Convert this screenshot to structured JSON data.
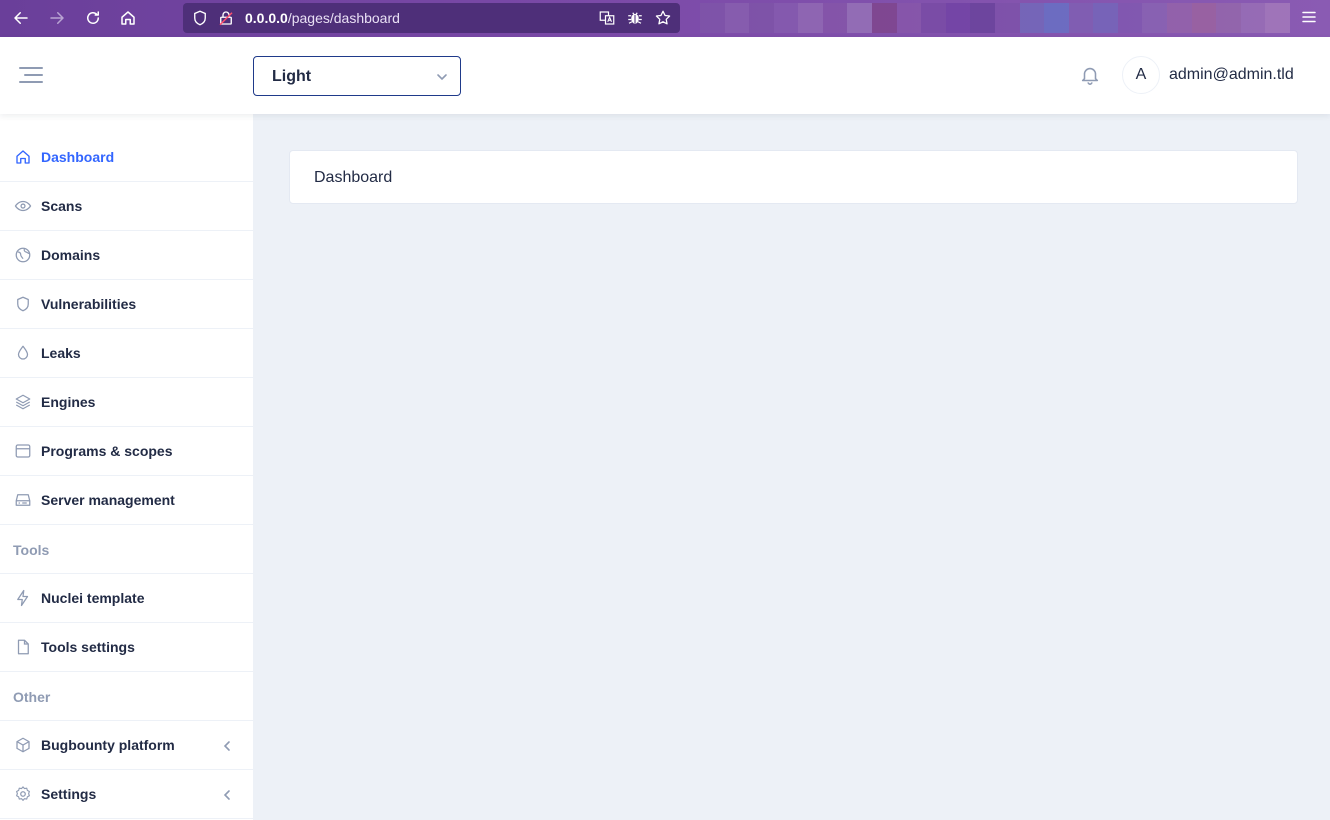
{
  "browser": {
    "url_host": "0.0.0.0",
    "url_path": "/pages/dashboard",
    "tab_colors": [
      "#7f5aa8",
      "#8c6ab0",
      "#7d57a5",
      "#8863b0",
      "#9a79b8",
      "#8659a8",
      "#a083bd",
      "#7e3f7c",
      "#8a5aa8",
      "#7447a0",
      "#6a3aa0",
      "#5b3a92",
      "#7a50a8",
      "#6a72bf",
      "#5a80cf",
      "#7b65b5",
      "#6b6fc0",
      "#7d5ab0",
      "#8a6ab5",
      "#9a6aa5",
      "#a56a95",
      "#9a70a8",
      "#a07ab8",
      "#b08ac0"
    ]
  },
  "header": {
    "theme_value": "Light",
    "avatar_initial": "A",
    "user_name": "admin@admin.tld"
  },
  "sidebar": {
    "items": [
      {
        "label": "Dashboard",
        "icon": "home-icon",
        "active": true
      },
      {
        "label": "Scans",
        "icon": "eye-icon"
      },
      {
        "label": "Domains",
        "icon": "globe-icon"
      },
      {
        "label": "Vulnerabilities",
        "icon": "shield-icon"
      },
      {
        "label": "Leaks",
        "icon": "droplet-icon"
      },
      {
        "label": "Engines",
        "icon": "layers-icon"
      },
      {
        "label": "Programs & scopes",
        "icon": "browser-icon"
      },
      {
        "label": "Server management",
        "icon": "hard-drive-icon"
      }
    ],
    "group_tools": "Tools",
    "tools_items": [
      {
        "label": "Nuclei template",
        "icon": "flash-icon"
      },
      {
        "label": "Tools settings",
        "icon": "file-icon"
      }
    ],
    "group_other": "Other",
    "other_items": [
      {
        "label": "Bugbounty platform",
        "icon": "cube-icon"
      },
      {
        "label": "Settings",
        "icon": "settings-icon"
      }
    ]
  },
  "main": {
    "card_title": "Dashboard"
  },
  "colors": {
    "accent": "#3366ff",
    "text": "#222b45",
    "muted": "#8f9bb3",
    "background": "#edf1f7"
  }
}
